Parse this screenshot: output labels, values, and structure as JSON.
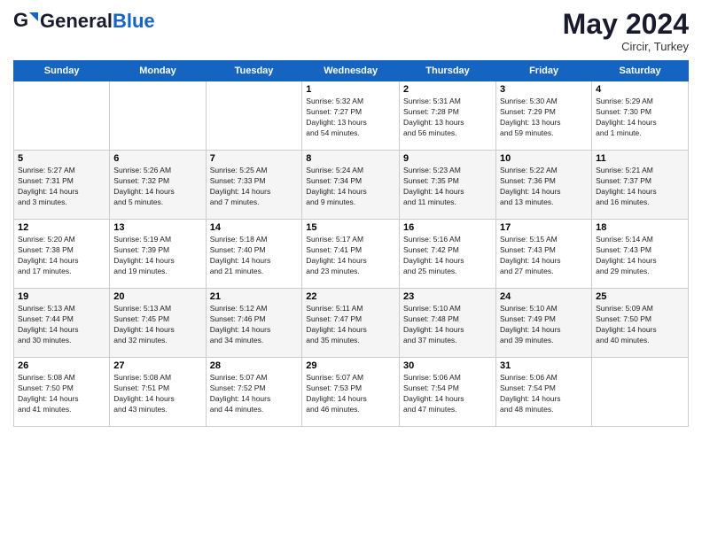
{
  "logo": {
    "text_general": "General",
    "text_blue": "Blue"
  },
  "header": {
    "month_year": "May 2024",
    "location": "Circir, Turkey"
  },
  "days_of_week": [
    "Sunday",
    "Monday",
    "Tuesday",
    "Wednesday",
    "Thursday",
    "Friday",
    "Saturday"
  ],
  "weeks": [
    [
      {
        "day": "",
        "info": ""
      },
      {
        "day": "",
        "info": ""
      },
      {
        "day": "",
        "info": ""
      },
      {
        "day": "1",
        "info": "Sunrise: 5:32 AM\nSunset: 7:27 PM\nDaylight: 13 hours\nand 54 minutes."
      },
      {
        "day": "2",
        "info": "Sunrise: 5:31 AM\nSunset: 7:28 PM\nDaylight: 13 hours\nand 56 minutes."
      },
      {
        "day": "3",
        "info": "Sunrise: 5:30 AM\nSunset: 7:29 PM\nDaylight: 13 hours\nand 59 minutes."
      },
      {
        "day": "4",
        "info": "Sunrise: 5:29 AM\nSunset: 7:30 PM\nDaylight: 14 hours\nand 1 minute."
      }
    ],
    [
      {
        "day": "5",
        "info": "Sunrise: 5:27 AM\nSunset: 7:31 PM\nDaylight: 14 hours\nand 3 minutes."
      },
      {
        "day": "6",
        "info": "Sunrise: 5:26 AM\nSunset: 7:32 PM\nDaylight: 14 hours\nand 5 minutes."
      },
      {
        "day": "7",
        "info": "Sunrise: 5:25 AM\nSunset: 7:33 PM\nDaylight: 14 hours\nand 7 minutes."
      },
      {
        "day": "8",
        "info": "Sunrise: 5:24 AM\nSunset: 7:34 PM\nDaylight: 14 hours\nand 9 minutes."
      },
      {
        "day": "9",
        "info": "Sunrise: 5:23 AM\nSunset: 7:35 PM\nDaylight: 14 hours\nand 11 minutes."
      },
      {
        "day": "10",
        "info": "Sunrise: 5:22 AM\nSunset: 7:36 PM\nDaylight: 14 hours\nand 13 minutes."
      },
      {
        "day": "11",
        "info": "Sunrise: 5:21 AM\nSunset: 7:37 PM\nDaylight: 14 hours\nand 16 minutes."
      }
    ],
    [
      {
        "day": "12",
        "info": "Sunrise: 5:20 AM\nSunset: 7:38 PM\nDaylight: 14 hours\nand 17 minutes."
      },
      {
        "day": "13",
        "info": "Sunrise: 5:19 AM\nSunset: 7:39 PM\nDaylight: 14 hours\nand 19 minutes."
      },
      {
        "day": "14",
        "info": "Sunrise: 5:18 AM\nSunset: 7:40 PM\nDaylight: 14 hours\nand 21 minutes."
      },
      {
        "day": "15",
        "info": "Sunrise: 5:17 AM\nSunset: 7:41 PM\nDaylight: 14 hours\nand 23 minutes."
      },
      {
        "day": "16",
        "info": "Sunrise: 5:16 AM\nSunset: 7:42 PM\nDaylight: 14 hours\nand 25 minutes."
      },
      {
        "day": "17",
        "info": "Sunrise: 5:15 AM\nSunset: 7:43 PM\nDaylight: 14 hours\nand 27 minutes."
      },
      {
        "day": "18",
        "info": "Sunrise: 5:14 AM\nSunset: 7:43 PM\nDaylight: 14 hours\nand 29 minutes."
      }
    ],
    [
      {
        "day": "19",
        "info": "Sunrise: 5:13 AM\nSunset: 7:44 PM\nDaylight: 14 hours\nand 30 minutes."
      },
      {
        "day": "20",
        "info": "Sunrise: 5:13 AM\nSunset: 7:45 PM\nDaylight: 14 hours\nand 32 minutes."
      },
      {
        "day": "21",
        "info": "Sunrise: 5:12 AM\nSunset: 7:46 PM\nDaylight: 14 hours\nand 34 minutes."
      },
      {
        "day": "22",
        "info": "Sunrise: 5:11 AM\nSunset: 7:47 PM\nDaylight: 14 hours\nand 35 minutes."
      },
      {
        "day": "23",
        "info": "Sunrise: 5:10 AM\nSunset: 7:48 PM\nDaylight: 14 hours\nand 37 minutes."
      },
      {
        "day": "24",
        "info": "Sunrise: 5:10 AM\nSunset: 7:49 PM\nDaylight: 14 hours\nand 39 minutes."
      },
      {
        "day": "25",
        "info": "Sunrise: 5:09 AM\nSunset: 7:50 PM\nDaylight: 14 hours\nand 40 minutes."
      }
    ],
    [
      {
        "day": "26",
        "info": "Sunrise: 5:08 AM\nSunset: 7:50 PM\nDaylight: 14 hours\nand 41 minutes."
      },
      {
        "day": "27",
        "info": "Sunrise: 5:08 AM\nSunset: 7:51 PM\nDaylight: 14 hours\nand 43 minutes."
      },
      {
        "day": "28",
        "info": "Sunrise: 5:07 AM\nSunset: 7:52 PM\nDaylight: 14 hours\nand 44 minutes."
      },
      {
        "day": "29",
        "info": "Sunrise: 5:07 AM\nSunset: 7:53 PM\nDaylight: 14 hours\nand 46 minutes."
      },
      {
        "day": "30",
        "info": "Sunrise: 5:06 AM\nSunset: 7:54 PM\nDaylight: 14 hours\nand 47 minutes."
      },
      {
        "day": "31",
        "info": "Sunrise: 5:06 AM\nSunset: 7:54 PM\nDaylight: 14 hours\nand 48 minutes."
      },
      {
        "day": "",
        "info": ""
      }
    ]
  ]
}
